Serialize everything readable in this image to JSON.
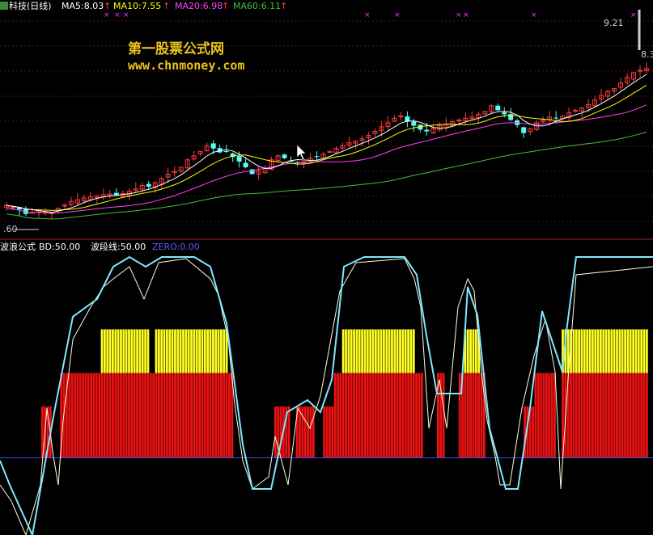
{
  "header": {
    "stock_title": "科技(日线)",
    "ma5": "MA5:8.03",
    "ma10": "MA10:7.55",
    "ma20": "MA20:6.98",
    "ma60": "MA60:6.11",
    "up_arrow": "↑"
  },
  "watermark": {
    "line1": "第一股票公式网",
    "line2": "www.chnmoney.com"
  },
  "price_labels": {
    "high_price": "9.21",
    "last_price": "8.3",
    "low_price": ".60"
  },
  "indicator_header": {
    "name": "波浪公式",
    "bd": "BD:50.00",
    "wave_line": "波段线:50.00",
    "zero": "ZERO:0.00"
  },
  "colors": {
    "up_candle": "#ff3c3c",
    "down_candle": "#54ffff",
    "ma5": "#ffffff",
    "ma10": "#ffff00",
    "ma20": "#ff40ff",
    "ma60": "#40c040",
    "yellow_bar": "#ffff22",
    "red_bar": "#ee1111",
    "wave_cyan": "#7fe8ff",
    "wave_white": "#ffffdd",
    "zero_line": "#4a4af0",
    "x_marker": "#ff30ff"
  },
  "chart_data": {
    "type": "candlestick",
    "price_ylim": [
      5.4,
      9.3
    ],
    "indicator_ylim": [
      -30,
      80
    ],
    "bd_levels": [
      50,
      33,
      20
    ],
    "close_series": [
      5.95,
      5.92,
      5.88,
      5.8,
      5.83,
      5.86,
      5.84,
      5.82,
      5.9,
      5.96,
      6.02,
      6.05,
      6.08,
      6.1,
      6.12,
      6.14,
      6.15,
      6.13,
      6.16,
      6.2,
      6.24,
      6.3,
      6.28,
      6.35,
      6.42,
      6.5,
      6.55,
      6.62,
      6.75,
      6.82,
      6.9,
      7.0,
      6.95,
      6.88,
      6.9,
      6.8,
      6.72,
      6.62,
      6.5,
      6.55,
      6.6,
      6.75,
      6.82,
      6.78,
      6.72,
      6.7,
      6.72,
      6.78,
      6.8,
      6.85,
      6.9,
      6.95,
      7.0,
      7.05,
      7.08,
      7.12,
      7.18,
      7.25,
      7.33,
      7.4,
      7.48,
      7.52,
      7.42,
      7.35,
      7.28,
      7.25,
      7.3,
      7.35,
      7.38,
      7.42,
      7.45,
      7.48,
      7.5,
      7.55,
      7.6,
      7.7,
      7.62,
      7.55,
      7.45,
      7.36,
      7.22,
      7.3,
      7.4,
      7.45,
      7.5,
      7.48,
      7.52,
      7.58,
      7.62,
      7.66,
      7.72,
      7.8,
      7.88,
      7.95,
      8.0,
      8.1,
      8.2,
      8.28,
      8.32,
      8.35
    ]
  }
}
